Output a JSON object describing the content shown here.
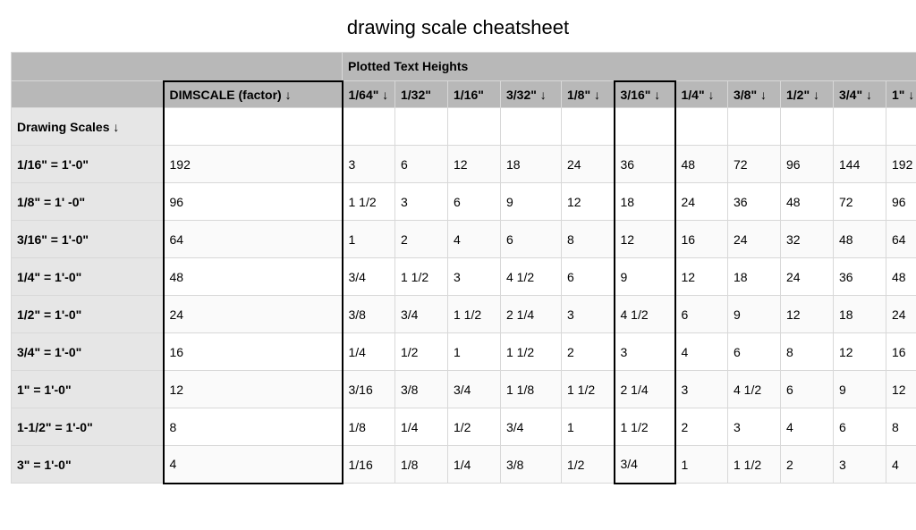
{
  "title": "drawing scale cheatsheet",
  "section_label": "Plotted Text Heights",
  "row_head_label": "Drawing Scales ↓",
  "dimscale_header": "DIMSCALE (factor)  ↓",
  "heights_headers": [
    "1/64\" ↓",
    "1/32\"",
    "1/16\"",
    "3/32\" ↓",
    "1/8\" ↓",
    "3/16\" ↓",
    "1/4\" ↓",
    "3/8\" ↓",
    "1/2\" ↓",
    "3/4\" ↓",
    "1\" ↓"
  ],
  "chart_data": {
    "type": "table",
    "title": "drawing scale cheatsheet",
    "columns": [
      "Drawing Scale",
      "DIMSCALE (factor)",
      "1/64\"",
      "1/32\"",
      "1/16\"",
      "3/32\"",
      "1/8\"",
      "3/16\"",
      "1/4\"",
      "3/8\"",
      "1/2\"",
      "3/4\"",
      "1\""
    ],
    "rows": [
      {
        "scale": "1/16\" = 1'-0\"",
        "dimscale": "192",
        "values": [
          "3",
          "6",
          "12",
          "18",
          "24",
          "36",
          "48",
          "72",
          "96",
          "144",
          "192"
        ]
      },
      {
        "scale": "1/8\" = 1' -0\"",
        "dimscale": "96",
        "values": [
          "1 1/2",
          "3",
          "6",
          "9",
          "12",
          "18",
          "24",
          "36",
          "48",
          "72",
          "96"
        ]
      },
      {
        "scale": "3/16\" = 1'-0\"",
        "dimscale": "64",
        "values": [
          "1",
          "2",
          "4",
          "6",
          "8",
          "12",
          "16",
          "24",
          "32",
          "48",
          "64"
        ]
      },
      {
        "scale": "1/4\" = 1'-0\"",
        "dimscale": "48",
        "values": [
          "3/4",
          "1 1/2",
          "3",
          "4 1/2",
          "6",
          "9",
          "12",
          "18",
          "24",
          "36",
          "48"
        ]
      },
      {
        "scale": "1/2\" = 1'-0\"",
        "dimscale": "24",
        "values": [
          "3/8",
          "3/4",
          "1 1/2",
          "2 1/4",
          "3",
          "4 1/2",
          "6",
          "9",
          "12",
          "18",
          "24"
        ]
      },
      {
        "scale": "3/4\" = 1'-0\"",
        "dimscale": "16",
        "values": [
          "1/4",
          "1/2",
          "1",
          "1 1/2",
          "2",
          "3",
          "4",
          "6",
          "8",
          "12",
          "16"
        ]
      },
      {
        "scale": "1\" = 1'-0\"",
        "dimscale": "12",
        "values": [
          "3/16",
          "3/8",
          "3/4",
          "1 1/8",
          "1 1/2",
          "2 1/4",
          "3",
          "4 1/2",
          "6",
          "9",
          "12"
        ]
      },
      {
        "scale": "1-1/2\" = 1'-0\"",
        "dimscale": "8",
        "values": [
          "1/8",
          "1/4",
          "1/2",
          "3/4",
          "1",
          "1 1/2",
          "2",
          "3",
          "4",
          "6",
          "8"
        ]
      },
      {
        "scale": "3\" = 1'-0\"",
        "dimscale": "4",
        "values": [
          "1/16",
          "1/8",
          "1/4",
          "3/8",
          "1/2",
          "3/4",
          "1",
          "1 1/2",
          "2",
          "3",
          "4"
        ]
      }
    ],
    "highlighted_columns": [
      "DIMSCALE (factor)",
      "3/16\""
    ]
  }
}
